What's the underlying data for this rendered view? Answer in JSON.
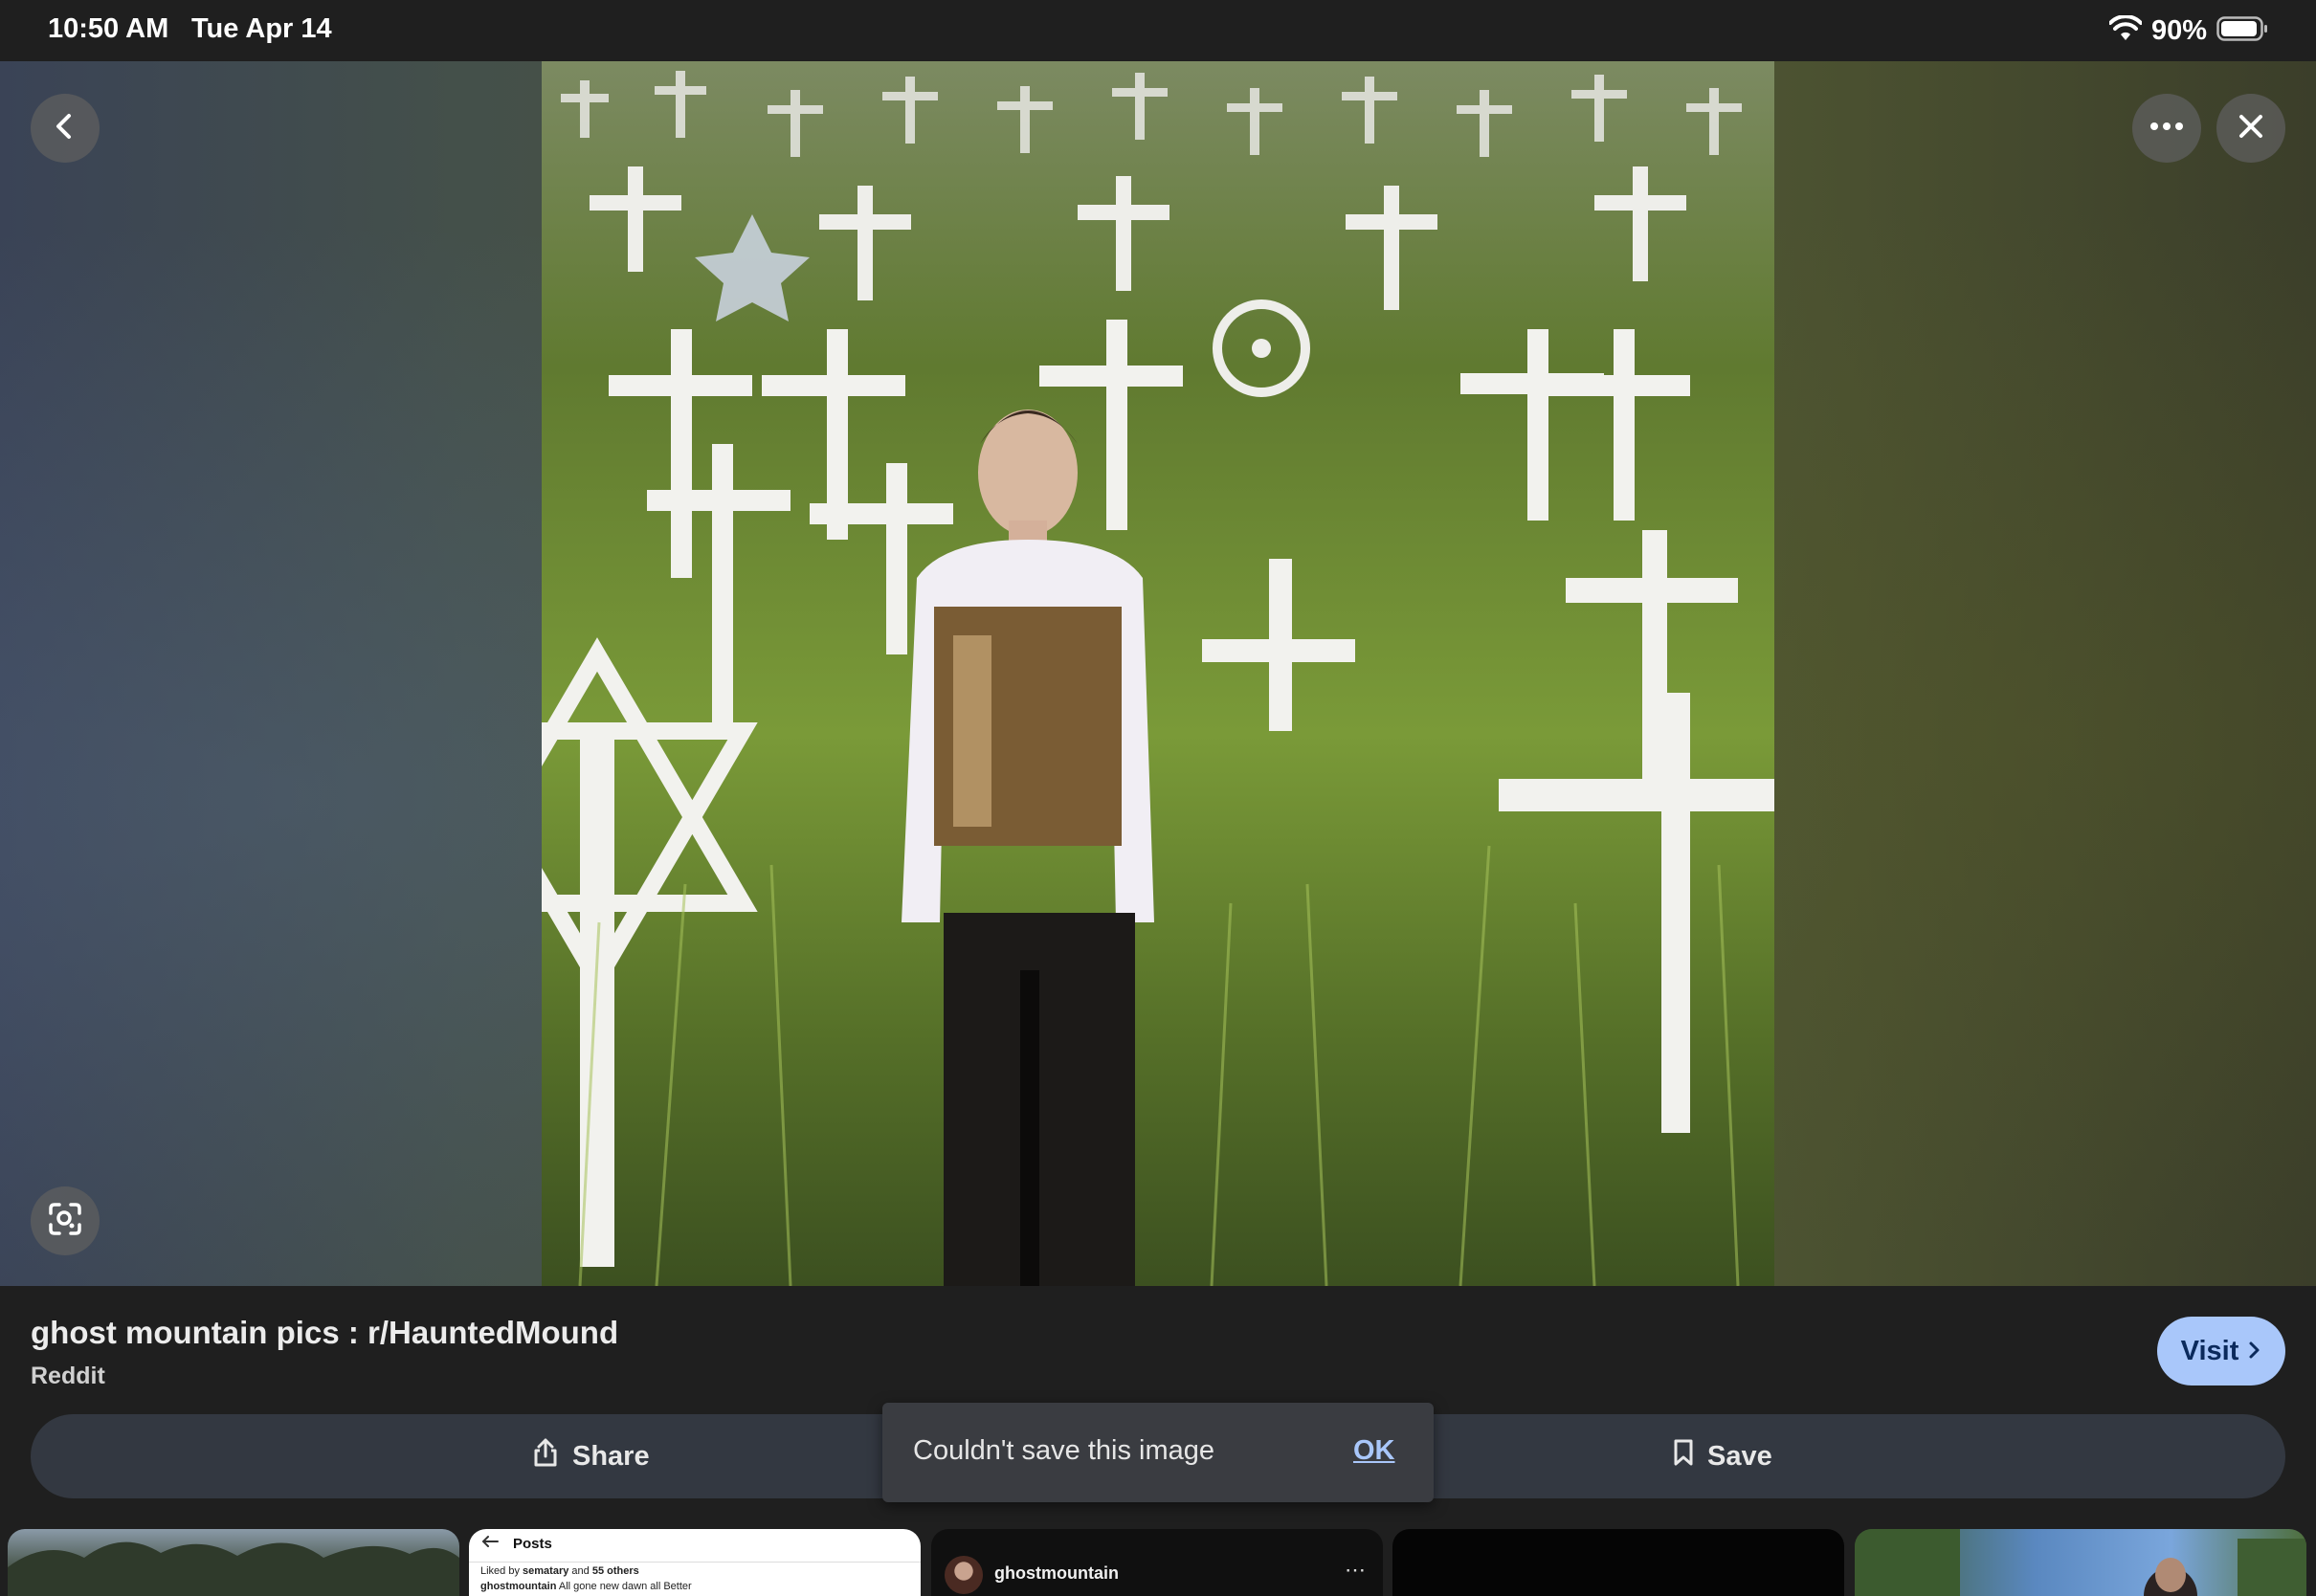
{
  "status_bar": {
    "time": "10:50 AM",
    "date": "Tue Apr 14",
    "battery": "90%",
    "wifi_icon": "wifi-icon",
    "battery_icon": "battery-icon"
  },
  "viewer": {
    "image_alt": "Young man in white graphic sweatshirt standing in a field of white crosses and grave markers",
    "back_icon": "chevron-left-icon",
    "more_icon": "more-horizontal-icon",
    "close_icon": "close-icon",
    "lens_icon": "lens-search-icon"
  },
  "info": {
    "title": "ghost mountain pics : r/HauntedMound",
    "source": "Reddit",
    "visit_label": "Visit"
  },
  "actions": {
    "share_label": "Share",
    "save_label": "Save"
  },
  "toast": {
    "message": "Couldn't save this image",
    "ok_label": "OK"
  },
  "thumbnails": {
    "t2": {
      "header": "Posts",
      "liked_prefix": "Liked by ",
      "liked_user": "sematary",
      "liked_mid": " and ",
      "liked_count": "55 others",
      "caption_user": "ghostmountain",
      "caption_text": " All gone new dawn all Better"
    },
    "t3": {
      "username": "ghostmountain",
      "dots": "⋯"
    }
  },
  "colors": {
    "accent": "#a9c7fa",
    "background": "#1f1f1f",
    "action_bar": "#333841",
    "toast_bg": "#3a3c41"
  }
}
